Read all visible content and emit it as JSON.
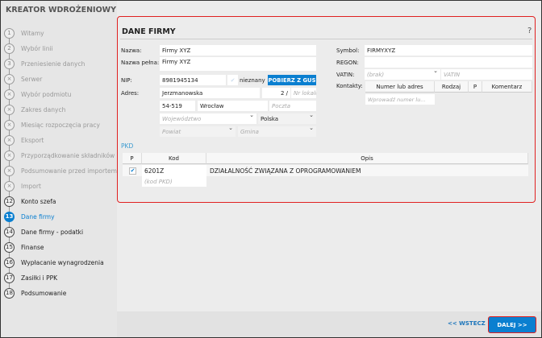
{
  "app_title": "KREATOR WDROŻENIOWY",
  "steps": [
    {
      "n": "1",
      "label": "Witamy",
      "state": "done"
    },
    {
      "n": "2",
      "label": "Wybór linii",
      "state": "done"
    },
    {
      "n": "3",
      "label": "Przeniesienie danych",
      "state": "done"
    },
    {
      "n": "×",
      "label": "Serwer",
      "state": "done"
    },
    {
      "n": "×",
      "label": "Wybór podmiotu",
      "state": "done"
    },
    {
      "n": "×",
      "label": "Zakres danych",
      "state": "done"
    },
    {
      "n": "×",
      "label": "Miesiąc rozpoczęcia pracy",
      "state": "done"
    },
    {
      "n": "×",
      "label": "Eksport",
      "state": "done"
    },
    {
      "n": "×",
      "label": "Przyporządkowanie składników",
      "state": "done"
    },
    {
      "n": "×",
      "label": "Podsumowanie przed importem",
      "state": "done"
    },
    {
      "n": "×",
      "label": "Import",
      "state": "done"
    },
    {
      "n": "12",
      "label": "Konto szefa",
      "state": "todo"
    },
    {
      "n": "13",
      "label": "Dane firmy",
      "state": "cur"
    },
    {
      "n": "14",
      "label": "Dane firmy - podatki",
      "state": "todo"
    },
    {
      "n": "15",
      "label": "Finanse",
      "state": "todo"
    },
    {
      "n": "16",
      "label": "Wypłacanie wynagrodzenia",
      "state": "todo"
    },
    {
      "n": "17",
      "label": "Zasiłki i PPK",
      "state": "todo"
    },
    {
      "n": "18",
      "label": "Podsumowanie",
      "state": "todo"
    }
  ],
  "main": {
    "title": "DANE FIRMY",
    "help": "?",
    "labels": {
      "nazwa": "Nazwa:",
      "nazwa_pelna": "Nazwa pełna:",
      "nip": "NIP:",
      "adres": "Adres:",
      "symbol": "Symbol:",
      "regon": "REGON:",
      "vatin": "VATIN:",
      "kontakty": "Kontakty:"
    },
    "nazwa": "Firmy XYZ",
    "nazwa_pelna": "Firmy XYZ",
    "nip": "8981945134",
    "nip_status": "nieznany",
    "gus_button": "POBIERZ Z GUS",
    "ulica": "Jerzmanowska",
    "nr_domu": "2 /",
    "nr_lokalu_ph": "Nr lokalu",
    "kod": "54-519",
    "miasto": "Wrocław",
    "poczta_ph": "Poczta",
    "wojewodztwo_ph": "Województwo",
    "kraj": "Polska",
    "powiat_ph": "Powiat",
    "gmina_ph": "Gmina",
    "symbol": "FIRMYXYZ",
    "regon": "",
    "vatin_select": "(brak)",
    "vatin_ph": "VATIN",
    "contacts_headers": [
      "Numer lub adres",
      "Rodzaj",
      "P",
      "Komentarz"
    ],
    "contacts_input_ph": "Wprowadź numer lu...",
    "pkd": {
      "label": "PKD",
      "headers": [
        "P",
        "Kod",
        "Opis"
      ],
      "rows": [
        {
          "checked": true,
          "kod": "6201Z",
          "opis": "DZIAŁALNOŚĆ ZWIĄZANA Z OPROGRAMOWANIEM"
        }
      ],
      "new_ph": "(kod PKD)"
    }
  },
  "footer": {
    "back": "<< WSTECZ",
    "next": "DALEJ >>"
  }
}
